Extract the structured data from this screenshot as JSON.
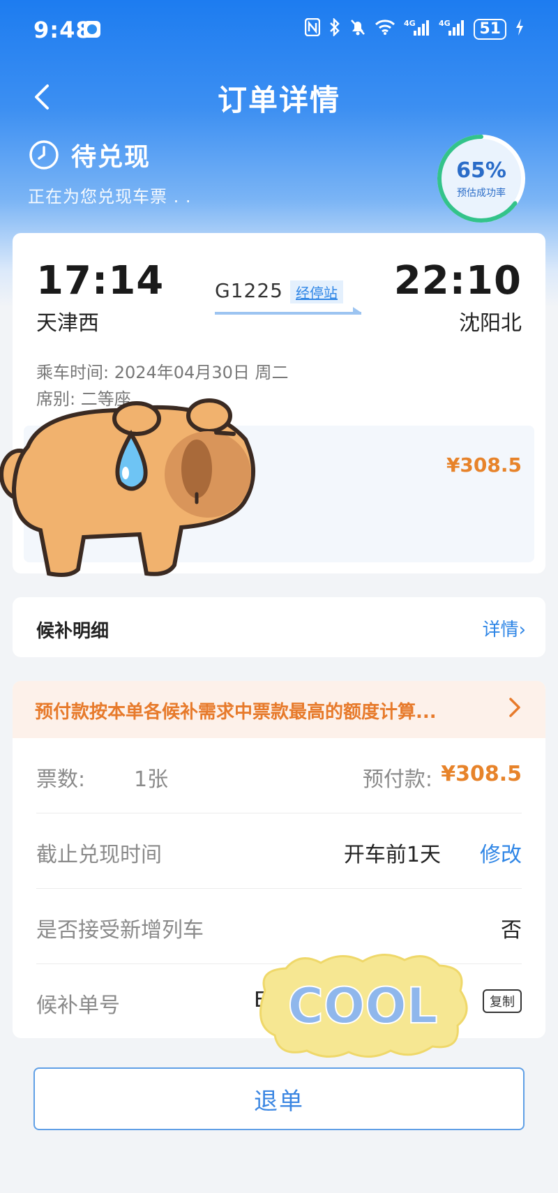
{
  "status_bar": {
    "time": "9:48",
    "network_1": "4G",
    "network_2": "4G",
    "battery": "51"
  },
  "nav": {
    "title": "订单详情"
  },
  "state": {
    "title": "待兑现",
    "subtitle": "正在为您兑现车票 . .",
    "success_rate": "65%",
    "success_rate_value": 0.65,
    "success_rate_label": "预估成功率"
  },
  "trip": {
    "dep_time": "17:14",
    "dep_station": "天津西",
    "arr_time": "22:10",
    "arr_station": "沈阳北",
    "train_no": "G1225",
    "stops_label": "经停站",
    "ride_date": "乘车时间: 2024年04月30日 周二",
    "seat": "席别: 二等座",
    "price": "¥308.5"
  },
  "detail": {
    "label": "候补明细",
    "link": "详情›"
  },
  "info": {
    "notice": "预付款按本单各候补需求中票款最高的额度计算...",
    "tickets_label": "票数:",
    "tickets_value": "1张",
    "prepay_label": "预付款:",
    "prepay_value": "¥308.5",
    "deadline_label": "截止兑现时间",
    "deadline_value": "开车前1天",
    "modify_label": "修改",
    "newtrain_label": "是否接受新增列车",
    "newtrain_value": "否",
    "order_label": "候补单号",
    "order_value": "E",
    "copy_label": "复制"
  },
  "sticker": {
    "text": "COOL"
  },
  "refund": {
    "label": "退单"
  },
  "colors": {
    "primary_blue": "#2f86e6",
    "orange": "#e7832a"
  }
}
